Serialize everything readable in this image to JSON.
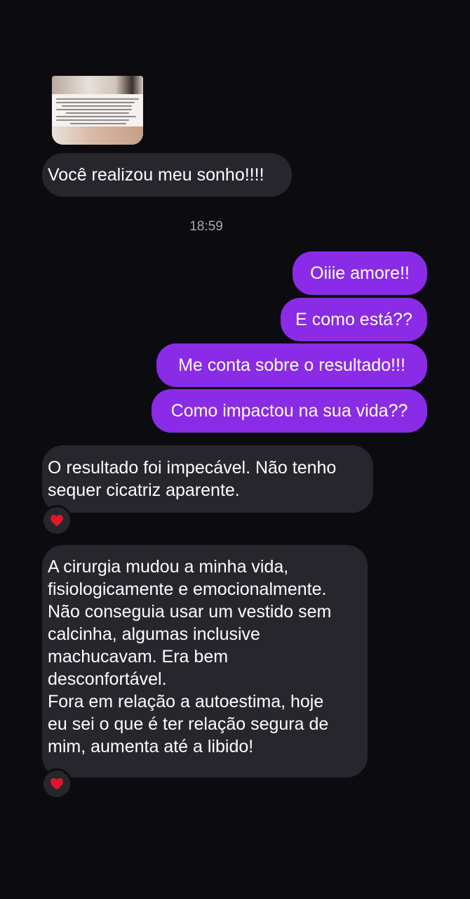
{
  "thread": {
    "timestamp": "18:59",
    "messages": [
      {
        "sender": "them",
        "text": "Você realizou meu sonho!!!!"
      },
      {
        "sender": "me",
        "text": "Oiiie amore!!"
      },
      {
        "sender": "me",
        "text": "E como está??"
      },
      {
        "sender": "me",
        "text": "Me conta sobre o resultado!!!"
      },
      {
        "sender": "me",
        "text": "Como impactou na sua vida??"
      },
      {
        "sender": "them",
        "lines": [
          "O resultado foi impecável. Não tenho",
          "sequer cicatriz aparente."
        ],
        "reaction": "heart-icon"
      },
      {
        "sender": "them",
        "lines": [
          "A cirurgia mudou a minha vida,",
          "fisiologicamente e emocionalmente.",
          "Não conseguia usar um vestido sem",
          "calcinha, algumas inclusive",
          "machucavam. Era bem",
          "desconfortável.",
          "Fora em relação a autoestima, hoje",
          "eu sei o que é ter relação segura de",
          "mim, aumenta até a libido!"
        ],
        "reaction": "heart-icon"
      }
    ]
  },
  "colors": {
    "background": "#0b0b10",
    "incoming_bubble": "#26262c",
    "outgoing_bubble": "#8a2be6",
    "timestamp": "#a7a7b0",
    "reaction_heart": "#e0162b"
  }
}
